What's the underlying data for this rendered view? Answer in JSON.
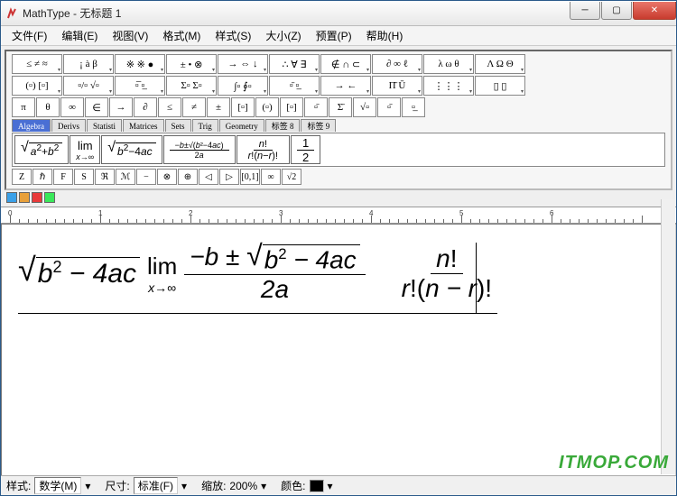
{
  "window": {
    "app": "MathType",
    "title": "MathType - 无标题 1"
  },
  "menu": [
    "文件(F)",
    "编辑(E)",
    "视图(V)",
    "格式(M)",
    "样式(S)",
    "大小(Z)",
    "预置(P)",
    "帮助(H)"
  ],
  "toolbar": {
    "row1": [
      "≤ ≠ ≈",
      "¡ à β",
      "※ ※ ●",
      "± • ⊗",
      "→ ⇔ ↓",
      "∴ ∀ ∃",
      "∉ ∩ ⊂",
      "∂ ∞ ℓ",
      "λ ω θ",
      "Λ Ω Θ"
    ],
    "row2": [
      "(▫) [▫]",
      "▫/▫ √▫",
      "▫̅ ▫̲",
      "Σ▫ Σ▫",
      "∫▫ ∮▫",
      "▫̄ ▫̲",
      "→ ←",
      "Π̄ Ū",
      "⋮⋮⋮",
      "▯ ▯"
    ],
    "row3": [
      "π",
      "θ",
      "∞",
      "∈",
      "→",
      "∂",
      "≤",
      "≠",
      "±",
      "[▫]",
      "(▫)",
      "[▫]",
      "▫̄",
      "Σ̄",
      "√▫",
      "▫̄",
      "▫̲"
    ],
    "tabs": [
      "Algebra",
      "Derivs",
      "Statisti",
      "Matrices",
      "Sets",
      "Trig",
      "Geometry",
      "标签 8",
      "标签 9"
    ],
    "active_tab": 0,
    "templates": [
      "√(a²+b²)",
      "lim x→∞",
      "√(b²−4ac)",
      "(−b±√(b²−4ac))/2a",
      "n!/(r!(n−r)!)",
      "1/2"
    ],
    "row4": [
      "Z",
      "ℏ",
      "F",
      "S",
      "ℜ",
      "ℳ",
      "−",
      "⊗",
      "⊕",
      "◁",
      "▷",
      "[0,1]",
      "∞",
      "√2"
    ]
  },
  "colors": [
    "#3aa0e8",
    "#e8a03a",
    "#e83a3a",
    "#3ae85a"
  ],
  "ruler": {
    "marks": [
      "0",
      "1",
      "2",
      "3",
      "4",
      "5",
      "6"
    ]
  },
  "equation": {
    "part1": "b² − 4ac",
    "lim": "lim",
    "limsub": "x→∞",
    "frac1_num": "−b ± √(b² − 4ac)",
    "frac1_den": "2a",
    "frac2_num": "n!",
    "frac2_den": "r!(n − r)!"
  },
  "status": {
    "style_lbl": "样式:",
    "style_val": "数学(M)",
    "size_lbl": "尺寸:",
    "size_val": "标准(F)",
    "zoom_lbl": "缩放:",
    "zoom_val": "200%",
    "color_lbl": "颜色:"
  },
  "watermark": "ITMOP.COM"
}
